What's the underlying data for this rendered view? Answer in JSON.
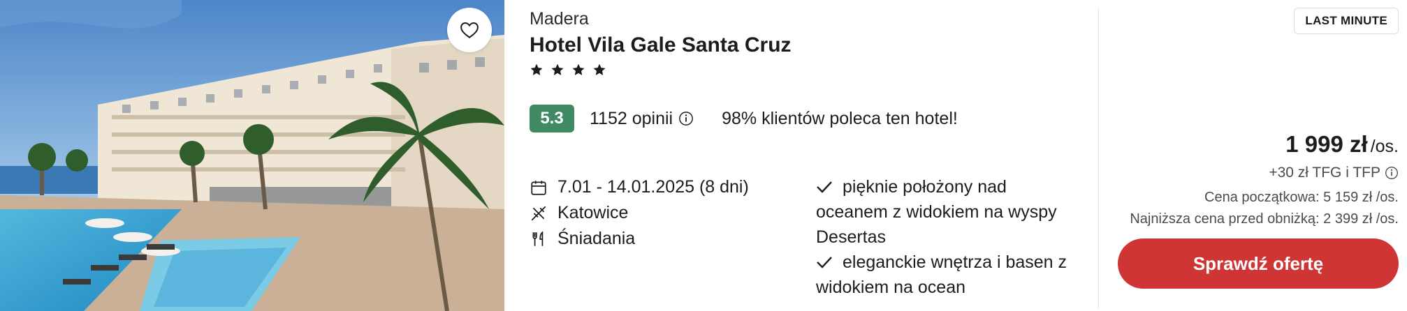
{
  "offer": {
    "region": "Madera",
    "hotel_name": "Hotel Vila Gale Santa Cruz",
    "stars": 4,
    "rating": "5.3",
    "opinions": "1152 opinii",
    "recommend": "98% klientów poleca ten hotel!",
    "details": {
      "dates": "7.01 - 14.01.2025 (8 dni)",
      "departure": "Katowice",
      "board": "Śniadania"
    },
    "features": [
      "pięknie położony nad oceanem z widokiem na wyspy Desertas",
      "eleganckie wnętrza i basen z widokiem na ocean"
    ],
    "badge": "LAST MINUTE",
    "price": {
      "amount": "1 999 zł",
      "unit": "/os.",
      "fees": "+30 zł TFG i TFP",
      "start_price": "Cena początkowa: 5 159 zł /os.",
      "lowest_price": "Najniższa cena przed obniżką: 2 399 zł /os."
    },
    "cta_label": "Sprawdź ofertę"
  },
  "icons": {
    "favorite": "heart-outline-icon",
    "star": "star-icon",
    "info": "info-circle-icon",
    "calendar": "calendar-icon",
    "flight": "plane-icon",
    "board": "cutlery-icon",
    "check": "check-icon"
  },
  "colors": {
    "rating_badge": "#3f8a63",
    "cta": "#cf3534"
  }
}
